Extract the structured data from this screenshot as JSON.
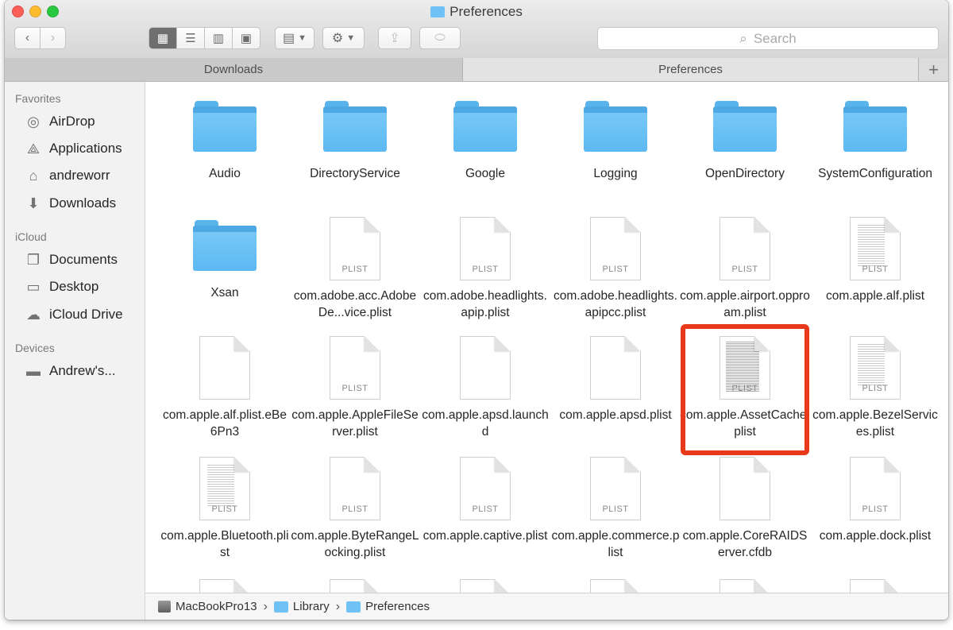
{
  "window": {
    "title": "Preferences"
  },
  "toolbar": {
    "back_icon": "chevron-left",
    "forward_icon": "chevron-right",
    "view_modes": [
      "icon-view",
      "list-view",
      "column-view",
      "gallery-view"
    ],
    "active_view": "icon-view",
    "search_placeholder": "Search"
  },
  "tabs": [
    {
      "label": "Downloads",
      "active": false
    },
    {
      "label": "Preferences",
      "active": true
    }
  ],
  "sidebar": {
    "sections": [
      {
        "title": "Favorites",
        "items": [
          {
            "label": "AirDrop",
            "icon": "airdrop-icon"
          },
          {
            "label": "Applications",
            "icon": "applications-icon"
          },
          {
            "label": "andreworr",
            "icon": "home-icon"
          },
          {
            "label": "Downloads",
            "icon": "downloads-icon"
          }
        ]
      },
      {
        "title": "iCloud",
        "items": [
          {
            "label": "Documents",
            "icon": "documents-icon"
          },
          {
            "label": "Desktop",
            "icon": "desktop-icon"
          },
          {
            "label": "iCloud Drive",
            "icon": "cloud-icon"
          }
        ]
      },
      {
        "title": "Devices",
        "items": [
          {
            "label": "Andrew's...",
            "icon": "laptop-icon"
          }
        ]
      }
    ]
  },
  "files": [
    {
      "name": "Audio",
      "kind": "folder"
    },
    {
      "name": "DirectoryService",
      "kind": "folder"
    },
    {
      "name": "Google",
      "kind": "folder"
    },
    {
      "name": "Logging",
      "kind": "folder"
    },
    {
      "name": "OpenDirectory",
      "kind": "folder"
    },
    {
      "name": "SystemConfiguration",
      "kind": "folder"
    },
    {
      "name": "Xsan",
      "kind": "folder"
    },
    {
      "name": "com.adobe.acc.AdobeDe...vice.plist",
      "kind": "plist",
      "ext": "PLIST"
    },
    {
      "name": "com.adobe.headlights.apip.plist",
      "kind": "plist",
      "ext": "PLIST"
    },
    {
      "name": "com.adobe.headlights.apipcc.plist",
      "kind": "plist",
      "ext": "PLIST"
    },
    {
      "name": "com.apple.airport.opproam.plist",
      "kind": "plist",
      "ext": "PLIST"
    },
    {
      "name": "com.apple.alf.plist",
      "kind": "plist-text",
      "ext": "PLIST"
    },
    {
      "name": "com.apple.alf.plist.eBe6Pn3",
      "kind": "blank"
    },
    {
      "name": "com.apple.AppleFileServer.plist",
      "kind": "plist",
      "ext": "PLIST"
    },
    {
      "name": "com.apple.apsd.launchd",
      "kind": "blank"
    },
    {
      "name": "com.apple.apsd.plist",
      "kind": "blank"
    },
    {
      "name": "com.apple.AssetCache.plist",
      "kind": "plist-dense",
      "ext": "PLIST",
      "highlighted": true
    },
    {
      "name": "com.apple.BezelServices.plist",
      "kind": "plist-text",
      "ext": "PLIST"
    },
    {
      "name": "com.apple.Bluetooth.plist",
      "kind": "plist-text",
      "ext": "PLIST"
    },
    {
      "name": "com.apple.ByteRangeLocking.plist",
      "kind": "plist",
      "ext": "PLIST"
    },
    {
      "name": "com.apple.captive.plist",
      "kind": "plist",
      "ext": "PLIST"
    },
    {
      "name": "com.apple.commerce.plist",
      "kind": "plist",
      "ext": "PLIST"
    },
    {
      "name": "com.apple.CoreRAIDServer.cfdb",
      "kind": "blank"
    },
    {
      "name": "com.apple.dock.plist",
      "kind": "plist",
      "ext": "PLIST"
    }
  ],
  "pathbar": [
    {
      "label": "MacBookPro13",
      "icon": "disk-icon"
    },
    {
      "label": "Library",
      "icon": "folder-icon"
    },
    {
      "label": "Preferences",
      "icon": "folder-icon"
    }
  ],
  "colors": {
    "highlight": "#e8391a",
    "folder": "#6ec2f5"
  }
}
